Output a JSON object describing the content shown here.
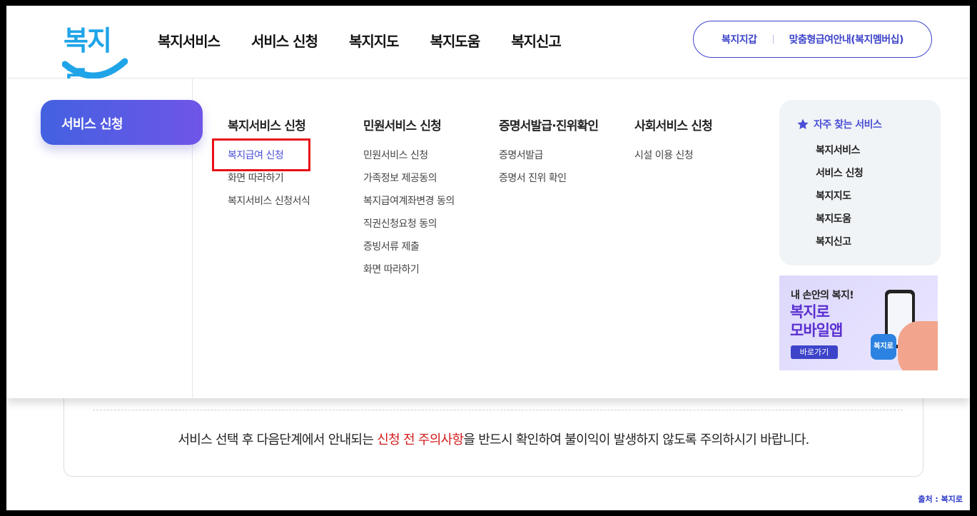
{
  "header": {
    "logo_text": "복지로",
    "nav": [
      "복지서비스",
      "서비스 신청",
      "복지지도",
      "복지도움",
      "복지신고"
    ],
    "util_links": [
      "복지지갑",
      "맞춤형급여안내(복지멤버십)"
    ]
  },
  "mega_menu": {
    "active_section": "서비스 신청",
    "columns": [
      {
        "title": "복지서비스 신청",
        "items": [
          "복지급여 신청",
          "화면 따라하기",
          "복지서비스 신청서식"
        ]
      },
      {
        "title": "민원서비스 신청",
        "items": [
          "민원서비스 신청",
          "가족정보 제공동의",
          "복지급여계좌변경 동의",
          "직권신청요청 동의",
          "증빙서류 제출",
          "화면 따라하기"
        ]
      },
      {
        "title": "증명서발급·진위확인",
        "items": [
          "증명서발급",
          "증명서 진위 확인"
        ]
      },
      {
        "title": "사회서비스 신청",
        "items": [
          "시설 이용 신청"
        ]
      }
    ],
    "favorites": {
      "title": "자주 찾는 서비스",
      "items": [
        "복지서비스",
        "서비스 신청",
        "복지지도",
        "복지도움",
        "복지신고"
      ]
    },
    "banner": {
      "subtitle": "내 손안의 복지!",
      "title_line1": "복지로",
      "title_line2": "모바일앱",
      "button": "바로가기",
      "app_icon_text": "복지로"
    }
  },
  "notice": {
    "before": "서비스 선택 후 다음단계에서 안내되는 ",
    "highlight": "신청 전 주의사항",
    "after": "을 반드시 확인하여 불이익이 발생하지 않도록 주의하시기 바랍니다."
  },
  "source": "출처 : 복지로",
  "colors": {
    "accent": "#3d44c9",
    "logo": "#1fa4e8",
    "highlight_box": "#e8101a",
    "notice_red": "#d31b1b"
  }
}
